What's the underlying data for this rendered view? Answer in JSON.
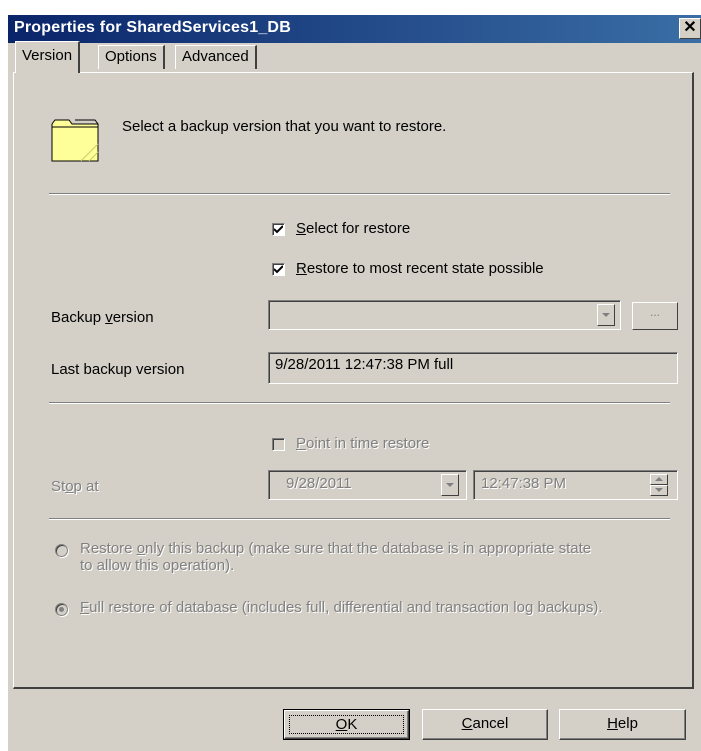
{
  "window": {
    "title": "Properties for SharedServices1_DB",
    "close_glyph": "✕"
  },
  "tabs": [
    {
      "label": "Version",
      "active": true
    },
    {
      "label": "Options",
      "active": false
    },
    {
      "label": "Advanced",
      "active": false
    }
  ],
  "header": {
    "icon": "folder-icon",
    "text": "Select a backup version that you want to restore."
  },
  "select_for_restore": {
    "label_prefix": "",
    "mnemonic": "S",
    "label_rest": "elect for restore",
    "checked": true
  },
  "restore_recent": {
    "label_prefix": "",
    "mnemonic": "R",
    "label_rest": "estore to most recent state possible",
    "checked": true
  },
  "backup_version": {
    "label_prefix": "Backup ",
    "mnemonic": "v",
    "label_rest": "ersion",
    "value": "",
    "browse_label": "..."
  },
  "last_backup": {
    "label": "Last backup version",
    "value": "9/28/2011 12:47:38 PM full"
  },
  "point_in_time": {
    "label_prefix": "",
    "mnemonic": "P",
    "label_rest": "oint in time restore",
    "checked": false,
    "enabled": false
  },
  "stop_at": {
    "label_prefix": "St",
    "mnemonic": "o",
    "label_rest": "p at",
    "date": "9/28/2011",
    "time": "12:47:38 PM"
  },
  "restore_only": {
    "line1_prefix": "Restore ",
    "mnemonic": "o",
    "line1_rest": "nly this backup (make sure that the database is in appropriate state",
    "line2": "to allow this operation).",
    "selected": false
  },
  "full_restore": {
    "line_prefix": "",
    "mnemonic": "F",
    "line_rest": "ull restore of database (includes full, differential and transaction log backups).",
    "selected": true
  },
  "buttons": {
    "ok": {
      "mnemonic": "O",
      "rest": "K"
    },
    "cancel": {
      "mnemonic": "C",
      "rest": "ancel"
    },
    "help": {
      "mnemonic": "H",
      "rest": "elp"
    }
  },
  "colors": {
    "face": "#d4d0c8",
    "title_start": "#0a246a",
    "title_end": "#3a6ea5",
    "folder": "#ffff99",
    "disabled_text": "#808080"
  }
}
